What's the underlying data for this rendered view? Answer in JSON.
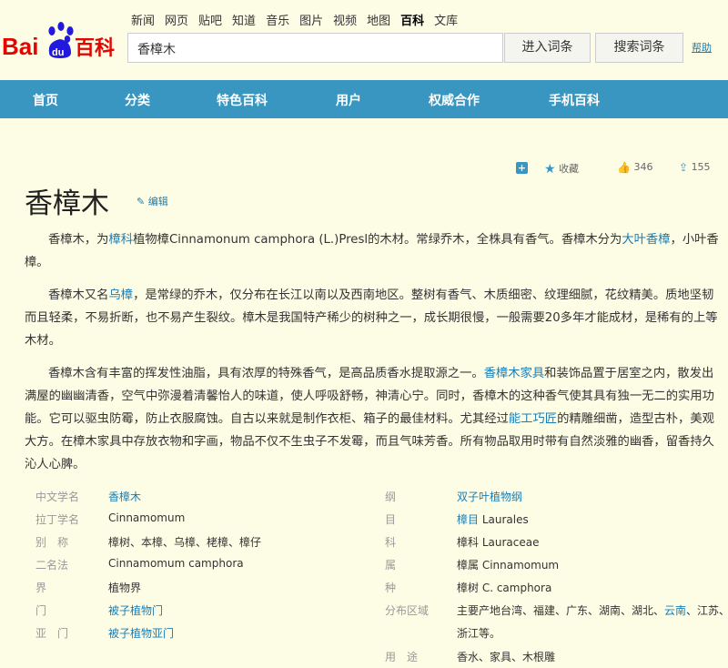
{
  "logo": {
    "text_bai": "Bai",
    "text_du": "du",
    "text_baike": "百科"
  },
  "topnav": [
    "新闻",
    "网页",
    "贴吧",
    "知道",
    "音乐",
    "图片",
    "视频",
    "地图",
    "百科",
    "文库"
  ],
  "search": {
    "value": "香樟木",
    "enter_label": "进入词条",
    "search_label": "搜索词条",
    "help_label": "帮助"
  },
  "mainnav": [
    "首页",
    "分类",
    "特色百科",
    "用户",
    "权威合作",
    "手机百科"
  ],
  "toolbar": {
    "favorite_label": "收藏",
    "likes": "346",
    "shares": "155"
  },
  "title": "香樟木",
  "edit_label": "编辑",
  "paragraphs": {
    "p1": {
      "a": "香樟木，为",
      "b": "樟科",
      "c": "植物樟Cinnamonum camphora (L.)Presl的木材。常绿乔木，全株具有香气。香樟木分为",
      "d": "大叶香樟",
      "e": "，小叶香樟。"
    },
    "p2": {
      "a": "香樟木又名",
      "b": "乌樟",
      "c": "，是常绿的乔木，仅分布在长江以南以及西南地区。整树有香气、木质细密、纹理细腻，花纹精美。质地坚韧而且轻柔，不易折断，也不易产生裂纹。樟木是我国特产稀少的树种之一，成长期很慢，一般需要20多年才能成材，是稀有的上等木材。"
    },
    "p3": {
      "a": "香樟木含有丰富的挥发性油脂，具有浓厚的特殊香气，是高品质香水提取源之一。",
      "b": "香樟木家具",
      "c": "和装饰品置于居室之内，散发出满屋的幽幽清香，空气中弥漫着清馨怡人的味道，使人呼吸舒畅，神清心宁。同时，香樟木的这种香气使其具有独一无二的实用功能。它可以驱虫防霉，防止衣服腐蚀。自古以来就是制作衣柜、箱子的最佳材料。尤其经过",
      "d": "能工巧匠",
      "e": "的精雕细凿，造型古朴，美观大方。在樟木家具中存放衣物和字画，物品不仅不生虫子不发霉，而且气味芳香。所有物品取用时带有自然淡雅的幽香，留香持久沁人心脾。"
    }
  },
  "info": {
    "left": [
      {
        "key": "中文学名",
        "value": "香樟木",
        "link": true
      },
      {
        "key": "拉丁学名",
        "value": "Cinnamomum",
        "link": false
      },
      {
        "key": "别　称",
        "value": "樟树、本樟、乌樟、栳樟、樟仔",
        "link": false
      },
      {
        "key": "二名法",
        "value": "Cinnamomum camphora",
        "link": false
      },
      {
        "key": "界",
        "value": "植物界",
        "link": false
      },
      {
        "key": "门",
        "value": "被子植物门",
        "link": true
      },
      {
        "key": "亚　门",
        "value": "被子植物亚门",
        "link": true
      }
    ],
    "right": [
      {
        "key": "纲",
        "value_link": "双子叶植物纲",
        "value_rest": ""
      },
      {
        "key": "目",
        "value_link": "樟目",
        "value_rest": " Laurales"
      },
      {
        "key": "科",
        "value_link": "",
        "value_rest": "樟科 Lauraceae"
      },
      {
        "key": "属",
        "value_link": "",
        "value_rest": "樟属 Cinnamomum"
      },
      {
        "key": "种",
        "value_link": "",
        "value_rest": "樟树 C. camphora"
      },
      {
        "key": "分布区域",
        "value_a": "主要产地台湾、福建、广东、湖南、湖北、",
        "value_link": "云南",
        "value_b": "、江苏、",
        "value_line2": "浙江等。"
      },
      {
        "key": "用　途",
        "value_link": "",
        "value_rest": "香水、家具、木根雕"
      }
    ]
  }
}
